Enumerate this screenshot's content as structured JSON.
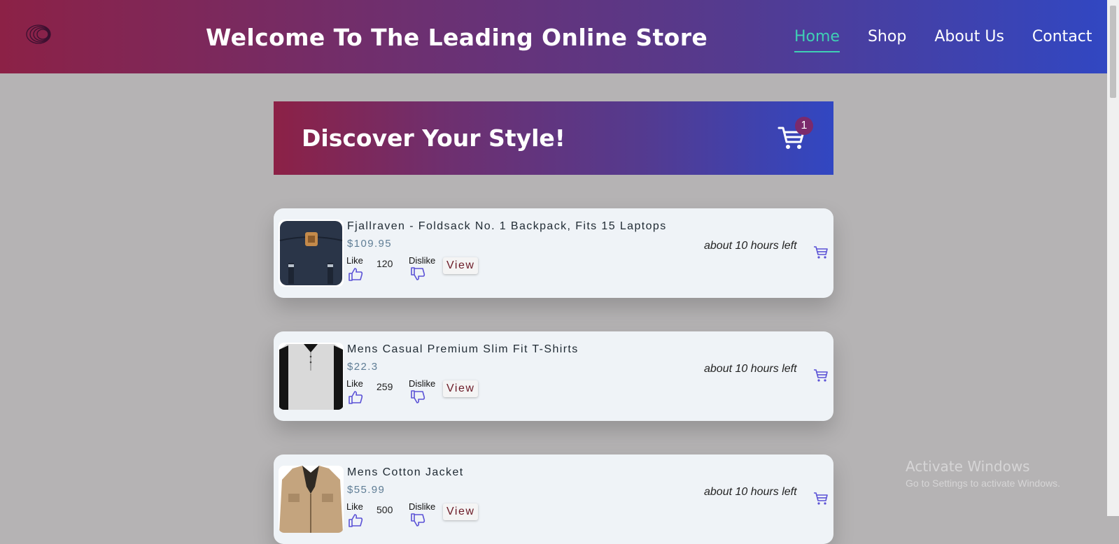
{
  "header": {
    "title": "Welcome To The Leading Online Store",
    "nav": [
      {
        "label": "Home",
        "active": true
      },
      {
        "label": "Shop",
        "active": false
      },
      {
        "label": "About Us",
        "active": false
      },
      {
        "label": "Contact",
        "active": false
      }
    ],
    "logo_icon": "concentric-circles-logo-icon"
  },
  "hero": {
    "heading": "Discover Your Style!",
    "cart_icon": "shopping-cart-icon",
    "cart_count": "1"
  },
  "products": [
    {
      "title": "Fjallraven - Foldsack No. 1 Backpack, Fits 15 Laptops",
      "price": "$109.95",
      "like_label": "Like",
      "likes": "120",
      "dislike_label": "Dislike",
      "view_label": "View",
      "time_left": "about 10 hours left"
    },
    {
      "title": "Mens Casual Premium Slim Fit T-Shirts",
      "price": "$22.3",
      "like_label": "Like",
      "likes": "259",
      "dislike_label": "Dislike",
      "view_label": "View",
      "time_left": "about 10 hours left"
    },
    {
      "title": "Mens Cotton Jacket",
      "price": "$55.99",
      "like_label": "Like",
      "likes": "500",
      "dislike_label": "Dislike",
      "view_label": "View",
      "time_left": "about 10 hours left"
    }
  ],
  "watermark": {
    "line1": "Activate Windows",
    "line2": "Go to Settings to activate Windows."
  },
  "colors": {
    "gradient_start": "#8c2146",
    "gradient_end": "#3147c2",
    "nav_active": "#3fd0b4",
    "icon_accent": "#5b52d6",
    "badge": "#7b2a6c"
  }
}
